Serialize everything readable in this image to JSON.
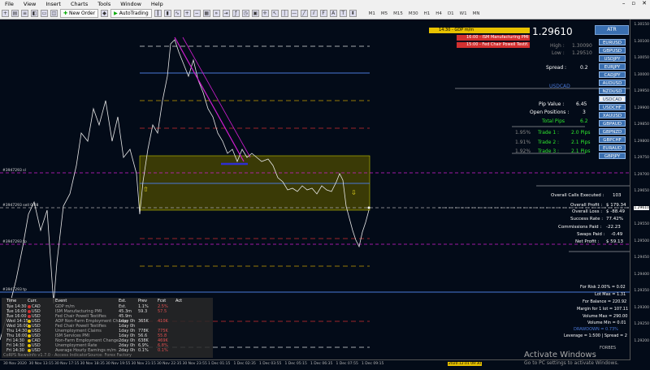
{
  "menu": {
    "items": [
      "File",
      "View",
      "Insert",
      "Charts",
      "Tools",
      "Window",
      "Help"
    ],
    "win_controls": [
      "–",
      "▫",
      "✕"
    ]
  },
  "toolbar": {
    "new_order": "New Order",
    "auto_trading": "AutoTrading",
    "timeframes": [
      "M1",
      "M5",
      "M15",
      "M30",
      "H1",
      "H4",
      "D1",
      "W1",
      "MN"
    ]
  },
  "colors": {
    "chart_bg": "#030b18",
    "zone_fill": "#3a3a06",
    "blue_line": "#4a78d8",
    "price_text": "#ffffff",
    "trend": "#d21ed2",
    "green": "#2ee82e",
    "button_blue": "#3a6fb0"
  },
  "price": {
    "current": "1.29610",
    "high_label": "High :",
    "high": "1.30090",
    "low_label": "Low :",
    "low": "1.29510",
    "spread_label": "Spread :",
    "spread": "0.2"
  },
  "atr_label": "ATR",
  "symbols": [
    "EURUSD",
    "GBPUSD",
    "USDJPY",
    "EURJPY",
    "CADJPY",
    "AUDUSD",
    "NZDUSD",
    "USDCAD",
    "USDCHF",
    "XAUUSD",
    "GBPAUD",
    "GBPNZD",
    "GBPCHF",
    "EURAUD",
    "GBPJPY"
  ],
  "selected_symbol": "USDCAD",
  "symbol_title": "USDCAD",
  "pip_value_label": "Pip Value :",
  "pip_value": "6.45",
  "open_positions_label": "Open Positions :",
  "open_positions": "3",
  "total_pips_label": "Total Pips",
  "total_pips": "6.2",
  "trades": [
    {
      "pct": "1.95%",
      "label": "Trade 1 :",
      "pips": "2.0 Pips"
    },
    {
      "pct": "1.91%",
      "label": "Trade 2 :",
      "pips": "2.1 Pips"
    },
    {
      "pct": "1.92%",
      "label": "Trade 3 :",
      "pips": "2.1 Pips"
    }
  ],
  "news": [
    {
      "text": "14:30 - GDP m/m",
      "color": "#e8c200"
    },
    {
      "text": "16:00 - ISM Manufacturing PMI",
      "color": "#d23030"
    },
    {
      "text": "15:00 - Fed Chair Powell Testif.",
      "color": "#d23030"
    }
  ],
  "stats": [
    {
      "label": "Overall Calls Executed :",
      "value": "103"
    },
    {
      "label": "Overall Profit :",
      "value": "$ 179.34"
    },
    {
      "label": "Overall Loss :",
      "value": "$ -88.49"
    },
    {
      "label": "Success Rate :",
      "value": "77.42%"
    },
    {
      "label": "Commissions Paid :",
      "value": "-22.23"
    },
    {
      "label": "Swaps Paid :",
      "value": "-0.49"
    },
    {
      "label": "Net Profit :",
      "value": "$ 59.13"
    }
  ],
  "risk": [
    {
      "text": "For Risk 2.00% = 0.02"
    },
    {
      "text": "Lot Max = 1.31"
    },
    {
      "text": "For Balance = 220.92"
    },
    {
      "text": "Margin for 1 lot = 107.11"
    },
    {
      "text": "Volume Max = 290.00"
    },
    {
      "text": "Volume Min = 0.01"
    },
    {
      "text": "DRAWDOWN = 0.73%"
    },
    {
      "text": "Leverage = 1:500 | Spread = 2"
    }
  ],
  "level_labels": [
    "#3947293 sl",
    "#3947293 sell 0.08",
    "#3947293 tp",
    "#3947293 tp"
  ],
  "price_axis": [
    "1.30150",
    "1.30100",
    "1.30050",
    "1.30000",
    "1.29950",
    "1.29900",
    "1.29850",
    "1.29800",
    "1.29750",
    "1.29700",
    "1.29650",
    "1.29610",
    "1.29550",
    "1.29500",
    "1.29450",
    "1.29400",
    "1.29350",
    "1.29300",
    "1.29250",
    "1.29200"
  ],
  "time_axis": [
    "30 Nov 2020",
    "30 Nov 13:15",
    "30 Nov 17:15",
    "30 Nov 18:35",
    "30 Nov 19:55",
    "30 Nov 21:15",
    "30 Nov 22:35",
    "30 Nov 23:55",
    "1 Dec 01:15",
    "1 Dec 02:35",
    "1 Dec 03:55",
    "1 Dec 05:15",
    "1 Dec 06:35",
    "1 Dec 07:55",
    "1 Dec 09:15"
  ],
  "cursor_time": "2020.12.01 09:30",
  "calendar": {
    "headers": [
      "Time",
      "Curr.",
      "Event",
      "Est.",
      "Prev",
      "Fcst",
      "Act"
    ],
    "rows": [
      [
        "Tue 14:30",
        "CAD",
        "GDP m/m",
        "Est.",
        "1.1%",
        "2.5%",
        ""
      ],
      [
        "Tue 16:00",
        "USD",
        "ISM Manufacturing PMI",
        "45.3m",
        "59.3",
        "57.5",
        ""
      ],
      [
        "Tue 16:00",
        "USD",
        "Fed Chair Powell Testifies",
        "45.9m",
        "",
        "",
        ""
      ],
      [
        "Wed 14:15",
        "USD",
        "ADP Non-Farm Employment Change",
        "1day 0h",
        "365K",
        "410K",
        ""
      ],
      [
        "Wed 16:00",
        "USD",
        "Fed Chair Powell Testifies",
        "1day 0h",
        "",
        "",
        ""
      ],
      [
        "Thu 14:30",
        "USD",
        "Unemployment Claims",
        "1day 0h",
        "778K",
        "775K",
        ""
      ],
      [
        "Thu 16:00",
        "USD",
        "ISM Services PMI",
        "1day 0h",
        "56.6",
        "55.8",
        ""
      ],
      [
        "Fri 14:30",
        "CAD",
        "Non-Farm Employment Change",
        "2day 0h",
        "638K",
        "469K",
        ""
      ],
      [
        "Fri 14:30",
        "USD",
        "Unemployment Rate",
        "2day 0h",
        "6.9%",
        "6.8%",
        ""
      ],
      [
        "Fri 14:30",
        "USD",
        "Average Hourly Earnings m/m",
        "2day 0h",
        "0.1%",
        "0.1%",
        ""
      ]
    ],
    "footer": "CoRPS NewsInfo v1.7.0 - Access Indicator",
    "footer2": "Source: Forex Factory"
  },
  "watermark": {
    "title": "Activate Windows",
    "subtitle": "Go to PC settings to activate Windows."
  },
  "forbes": "FORBES"
}
